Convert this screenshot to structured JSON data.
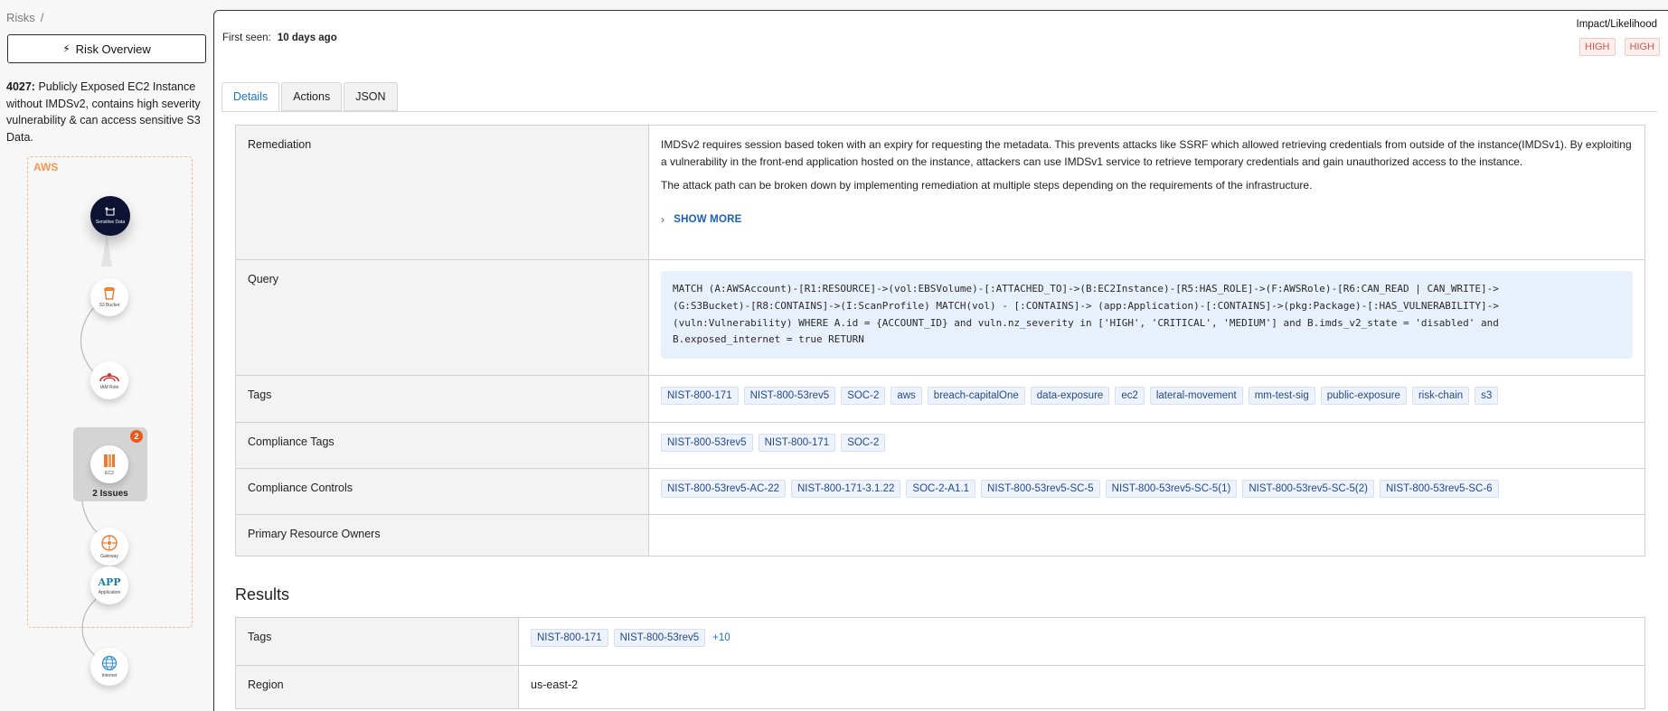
{
  "breadcrumb": {
    "root": "Risks",
    "separator": "/"
  },
  "risk_overview_button": "Risk Overview",
  "risk": {
    "id": "4027:",
    "title": "Publicly Exposed EC2 Instance without IMDSv2, contains high severity vulnerability & can access sensitive S3 Data."
  },
  "graph": {
    "cloud_label": "AWS",
    "nodes": [
      {
        "name": "sensitive-data",
        "label": "Sensitive Data"
      },
      {
        "name": "s3-bucket",
        "label": "S3 Bucket"
      },
      {
        "name": "iam-role",
        "label": "IAM Role"
      },
      {
        "name": "ec2",
        "label": "EC2"
      },
      {
        "name": "gateway",
        "label": "Gateway"
      },
      {
        "name": "application",
        "label": "Application",
        "glyph": "APP"
      },
      {
        "name": "internet",
        "label": "Internet"
      }
    ],
    "ec2_badge": "2",
    "ec2_issues": "2 Issues",
    "colors": {
      "orange": "#f07a2b",
      "red": "#d0352f",
      "blue": "#2d8bd6",
      "dark": "#0d1433"
    }
  },
  "header": {
    "first_seen_label": "First seen:",
    "first_seen_value": "10 days ago",
    "impact_label": "Impact/Likelihood",
    "impact": "HIGH",
    "likelihood": "HIGH"
  },
  "tabs": [
    "Details",
    "Actions",
    "JSON"
  ],
  "details": {
    "remediation_label": "Remediation",
    "remediation_p1": "IMDSv2 requires session based token with an expiry for requesting the metadata. This prevents attacks like SSRF which allowed retrieving credentials from outside of the instance(IMDSv1). By exploiting a vulnerability in the front-end application hosted on the instance, attackers can use IMDSv1 service to retrieve temporary credentials and gain unauthorized access to the instance.",
    "remediation_p2": "The attack path can be broken down by implementing remediation at multiple steps depending on the requirements of the infrastructure.",
    "show_more": "SHOW MORE",
    "query_label": "Query",
    "query_lines": [
      "MATCH (A:AWSAccount)-[R1:RESOURCE]->(vol:EBSVolume)-[:ATTACHED_TO]->(B:EC2Instance)-[R5:HAS_ROLE]->(F:AWSRole)-[R6:CAN_READ | CAN_WRITE]->",
      "(G:S3Bucket)-[R8:CONTAINS]->(I:ScanProfile) MATCH(vol) - [:CONTAINS]-> (app:Application)-[:CONTAINS]->(pkg:Package)-[:HAS_VULNERABILITY]->",
      "(vuln:Vulnerability) WHERE A.id = {ACCOUNT_ID} and vuln.nz_severity in ['HIGH', 'CRITICAL', 'MEDIUM'] and B.imds_v2_state = 'disabled' and",
      "B.exposed_internet = true RETURN"
    ],
    "tags_label": "Tags",
    "tags": [
      "NIST-800-171",
      "NIST-800-53rev5",
      "SOC-2",
      "aws",
      "breach-capitalOne",
      "data-exposure",
      "ec2",
      "lateral-movement",
      "mm-test-sig",
      "public-exposure",
      "risk-chain",
      "s3"
    ],
    "compliance_tags_label": "Compliance Tags",
    "compliance_tags": [
      "NIST-800-53rev5",
      "NIST-800-171",
      "SOC-2"
    ],
    "compliance_controls_label": "Compliance Controls",
    "compliance_controls": [
      "NIST-800-53rev5-AC-22",
      "NIST-800-171-3.1.22",
      "SOC-2-A1.1",
      "NIST-800-53rev5-SC-5",
      "NIST-800-53rev5-SC-5(1)",
      "NIST-800-53rev5-SC-5(2)",
      "NIST-800-53rev5-SC-6"
    ],
    "owners_label": "Primary Resource Owners",
    "owners_value": ""
  },
  "results": {
    "title": "Results",
    "tags_label": "Tags",
    "tags": [
      "NIST-800-171",
      "NIST-800-53rev5"
    ],
    "tags_more": "+10",
    "region_label": "Region",
    "region_value": "us-east-2"
  }
}
